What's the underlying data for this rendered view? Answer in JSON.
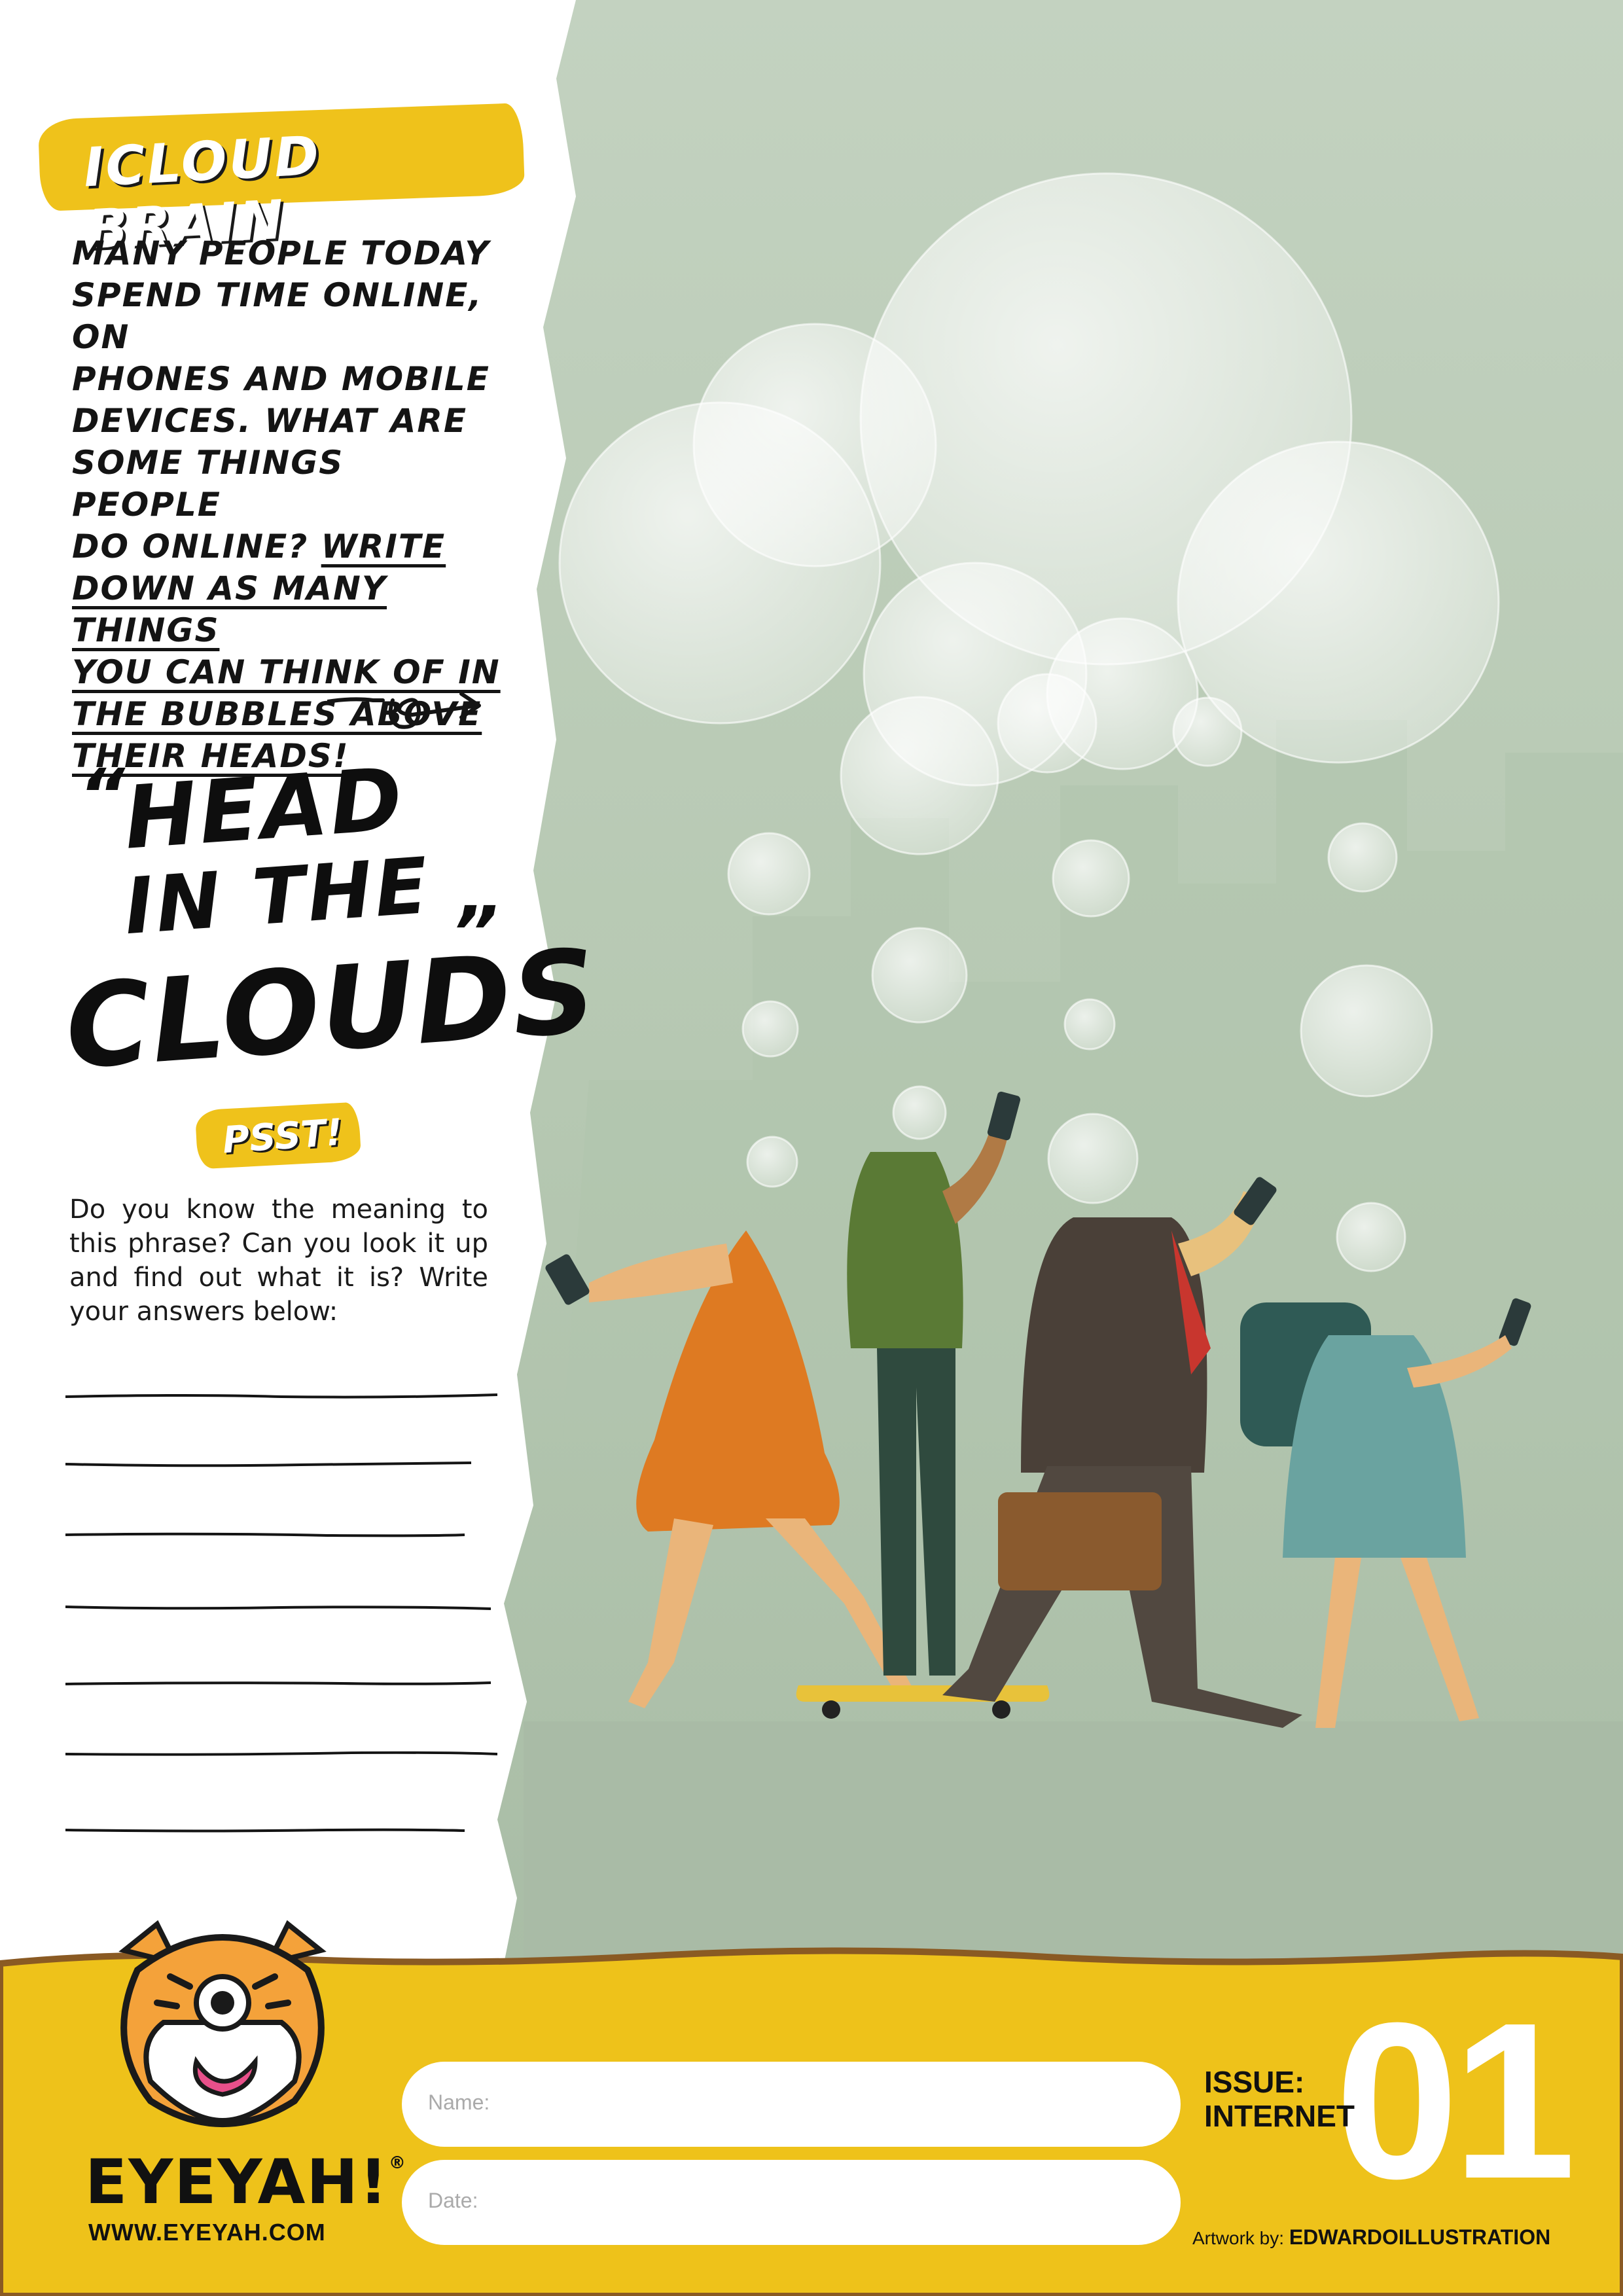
{
  "worksheet": {
    "title": "ICLOUD BRAIN",
    "intro_line1": "MANY PEOPLE TODAY",
    "intro_line2": "SPEND TIME ONLINE, ON",
    "intro_line3": "PHONES AND MOBILE",
    "intro_line4": "DEVICES. WHAT ARE",
    "intro_line5": "SOME THINGS PEOPLE",
    "intro_line6_plain": "DO ONLINE? ",
    "intro_line6_underlined": "WRITE",
    "intro_line7": "DOWN AS MANY THINGS",
    "intro_line8": "YOU CAN THINK OF IN",
    "intro_line9": "THE BUBBLES ABOVE",
    "intro_line10": "THEIR HEADS!",
    "quote_open": "“",
    "quote_line1": "HEAD",
    "quote_line2": "IN THE",
    "quote_line3": "CLOUDS",
    "quote_close": "”",
    "psst_label": "PSST!",
    "question": "Do you know the meaning to this phrase? Can you look it up and find out what it is? Write your answers below:",
    "answer_line_count": 7
  },
  "footer": {
    "brand": "EYEYAH",
    "brand_mark": "!",
    "brand_tm": "®",
    "url": "WWW.EYEYAH.COM",
    "name_label": "Name:",
    "date_label": "Date:",
    "issue_label": "ISSUE:",
    "issue_topic": "INTERNET",
    "issue_number": "01",
    "credit_prefix": "Artwork by: ",
    "credit_artist": "EDWARDOILLUSTRATION"
  },
  "colors": {
    "accent_yellow": "#efc21b",
    "footer_yellow": "#eec21a",
    "footer_border": "#8a5a23",
    "sage_background": "#bfd0bc",
    "text_dark": "#141414"
  },
  "icons": [
    "tiger-mascot-icon",
    "curly-arrow-icon",
    "thought-bubble-icon"
  ]
}
